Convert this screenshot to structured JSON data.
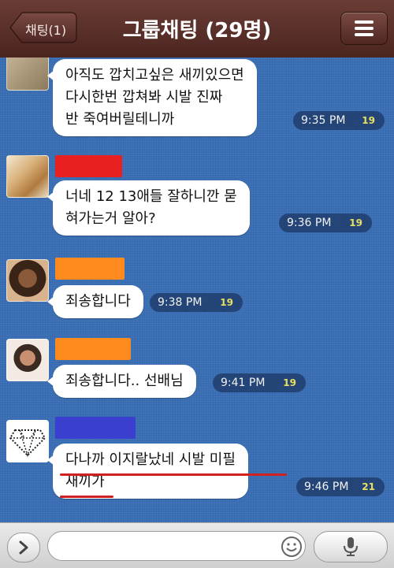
{
  "header": {
    "back_label": "채팅(1)",
    "title": "그룹채팅 (29명)",
    "menu_icon": "menu-icon"
  },
  "colors": {
    "header": "#5a2f29",
    "chat_background": "#3a6fb5",
    "underline": "#d02020",
    "name_red": "#e82020",
    "name_orange": "#ff8a1e",
    "name_blue": "#3a3fd0"
  },
  "messages": [
    {
      "lines": [
        "아직도 깝치고싶은 새끼있으면",
        " 다시한번 깝쳐봐 시발 진짜",
        "반 죽여버릴테니까"
      ],
      "time": "9:35 PM",
      "unread": "19"
    },
    {
      "lines": [
        "너네 12 13애들 잘하니깐 묻",
        "혀가는거 알아?"
      ],
      "time": "9:36 PM",
      "unread": "19"
    },
    {
      "lines": [
        "죄송합니다"
      ],
      "time": "9:38 PM",
      "unread": "19"
    },
    {
      "lines": [
        "죄송합니다.. 선배님"
      ],
      "time": "9:41 PM",
      "unread": "19"
    },
    {
      "lines": [
        "다나까 이지랄났네 시발 미필",
        "새끼가"
      ],
      "time": "9:46 PM",
      "unread": "21"
    }
  ],
  "input": {
    "value": "",
    "expand_icon": "chevron-right-icon",
    "emoji_icon": "emoji-icon",
    "mic_icon": "microphone-icon"
  }
}
